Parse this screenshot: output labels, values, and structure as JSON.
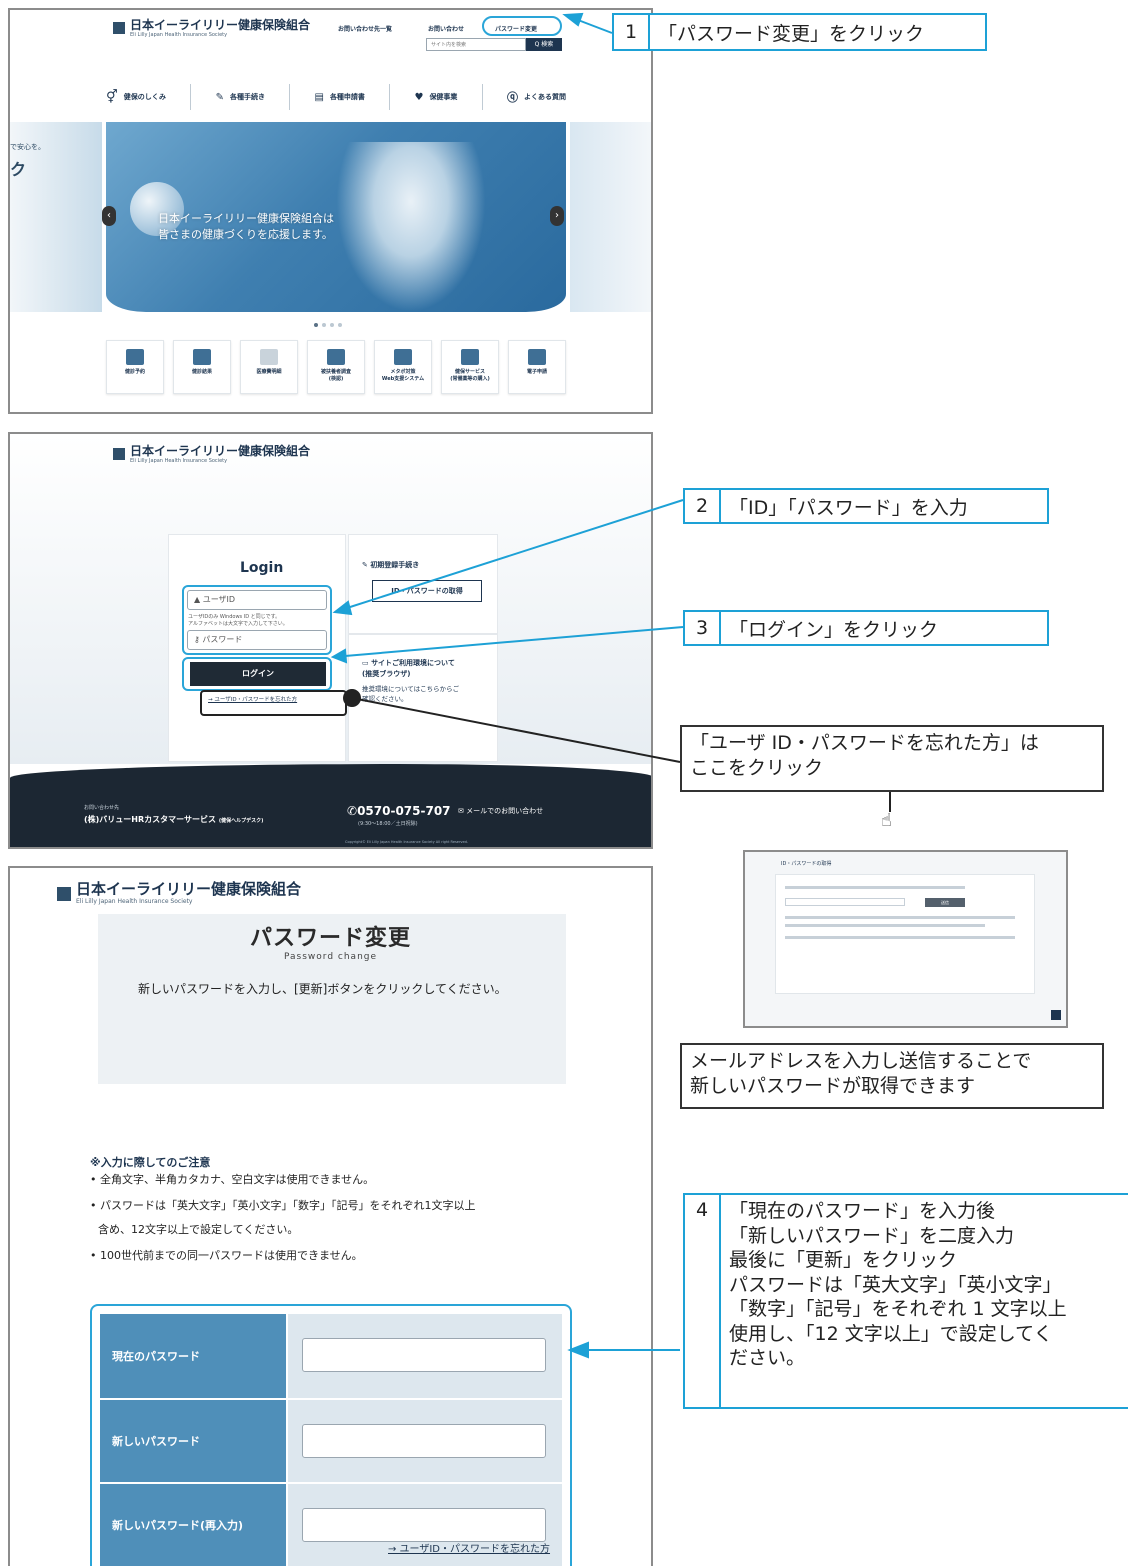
{
  "brand": {
    "name": "日本イーライリリー健康保険組合",
    "sub": "Eli Lilly Japan Health Insurance Society"
  },
  "home": {
    "header_links": [
      "お問い合わせ先一覧",
      "お問い合わせ",
      "パスワード変更"
    ],
    "search_placeholder": "サイト内を検索",
    "search_button": "Q 検索",
    "nav": [
      "健保のしくみ",
      "各種手続き",
      "各種申請書",
      "保健事業",
      "よくある質問"
    ],
    "hero_text_line1": "日本イーライリリー健康保険組合は",
    "hero_text_line2": "皆さまの健康づくりを応援します。",
    "hero_left_fragment_1": "で安心を。",
    "hero_left_fragment_2": "ク",
    "tiles": [
      "健診予約",
      "健診結果",
      "医療費明細",
      "被扶養者調査\n(検認)",
      "メタボ対策\nWeb支援システム",
      "健保サービス\n(常備薬等の購入)",
      "電子申請"
    ]
  },
  "login": {
    "title": "Login",
    "user_placeholder": "ユーザID",
    "user_note": "ユーザIDのみ Windows ID と同じです。\nアルファベットは大文字で入力して下さい。",
    "password_placeholder": "パスワード",
    "login_button": "ログイン",
    "forgot_link": "→ ユーザID・パスワードを忘れた方",
    "first_time_heading": "初期登録手続き",
    "get_id_button": "ID・パスワードの取得",
    "env_heading": "サイトご利用環境について\n(推奨ブラウザ)",
    "env_text": "推奨環境についてはこちらからご\n確認ください。",
    "footer_contact_label": "お問い合わせ先",
    "footer_company": "(株)バリューHRカスタマーサービス",
    "footer_company_note": "(健保ヘルプデスク)",
    "footer_phone": "0570-075-707",
    "footer_hours": "(9:30〜18:00／土日祝除)",
    "footer_mail": "メールでのお問い合わせ",
    "copyright": "Copyright© Eli Lilly Japan Health Insurance Society All right Reserved."
  },
  "pwchange": {
    "title": "パスワード変更",
    "subtitle": "Password change",
    "intro": "新しいパスワードを入力し、[更新]ボタンをクリックしてください。",
    "caution_heading": "※入力に際してのご注意",
    "caution_1": "全角文字、半角カタカナ、空白文字は使用できません。",
    "caution_2a": "パスワードは「英大文字」「英小文字」「数字」「記号」をそれぞれ1文字以上",
    "caution_2b": "含め、12文字以上で設定してください。",
    "caution_3": "100世代前までの同一パスワードは使用できません。",
    "labels": [
      "現在のパスワード",
      "新しいパスワード",
      "新しいパスワード(再入力)"
    ],
    "forgot_link": "→ ユーザID・パスワードを忘れた方"
  },
  "callouts": {
    "c1_num": "1",
    "c1_text": "「パスワード変更」をクリック",
    "c2_num": "2",
    "c2_text": "「ID」「パスワード」を入力",
    "c3_num": "3",
    "c3_text": "「ログイン」をクリック",
    "c4_num": "4",
    "c4_lines": [
      "「現在のパスワード」を入力後",
      "「新しいパスワード」を二度入力",
      "最後に「更新」をクリック",
      "パスワードは「英大文字」「英小文字」",
      "「数字」「記号」をそれぞれ 1 文字以上",
      "使用し、「12 文字以上」で設定してく",
      "ださい。"
    ],
    "forgot_note_1": "「ユーザ ID・パスワードを忘れた方」は",
    "forgot_note_2": "ここをクリック",
    "mail_note_1": "メールアドレスを入力し送信することで",
    "mail_note_2": "新しいパスワードが取得できます"
  },
  "thumb": {
    "title": "ID・パスワードの取得",
    "button": "送信"
  },
  "colors": {
    "callout_blue": "#1da1d6",
    "brand_navy": "#1e3550",
    "form_blue": "#4f8fb9"
  }
}
